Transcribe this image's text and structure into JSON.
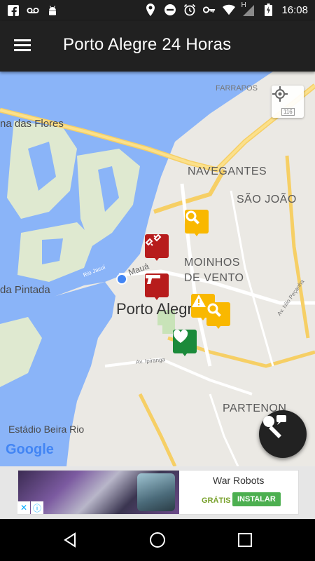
{
  "status_bar": {
    "time": "16:08",
    "left_icons": [
      "facebook-icon",
      "voicemail-icon",
      "android-icon"
    ],
    "right_icons": [
      "location-icon",
      "do-not-disturb-icon",
      "alarm-icon",
      "key-icon",
      "wifi-icon",
      "signal-h-icon",
      "battery-icon"
    ],
    "signal_letter": "H"
  },
  "app_bar": {
    "title": "Porto Alegre 24 Horas",
    "menu_icon": "hamburger-menu-icon"
  },
  "map": {
    "labels": {
      "farrapos": "FARRAPOS",
      "ilha_flores": "na das Flores",
      "navegantes": "NAVEGANTES",
      "sao_joao": "SÃO JOÃO",
      "moinhos": "MOINHOS\nDE VENTO",
      "maua": "Mauá",
      "rio_jacui": "Rio Jacuí",
      "da_pintada": "da Pintada",
      "porto_alegre": "Porto Alegre",
      "av_nilo": "Av. Nilo Peçanha",
      "av_ipiranga": "Av. Ipiranga",
      "partenon": "PARTENON",
      "estadio": "Estádio Beira Rio",
      "highway": "116"
    },
    "google_logo": "Google",
    "locate_icon": "my-location-icon",
    "markers": [
      {
        "name": "chain-incident-marker",
        "icon": "broken-chain-icon",
        "color": "#b71c1c"
      },
      {
        "name": "gun-incident-marker",
        "icon": "gun-icon",
        "color": "#b71c1c"
      },
      {
        "name": "search-marker-1",
        "icon": "magnifier-icon",
        "color": "#f9b800"
      },
      {
        "name": "warning-marker",
        "icon": "warning-icon",
        "color": "#f9b800"
      },
      {
        "name": "search-marker-2",
        "icon": "magnifier-icon",
        "color": "#f9b800"
      },
      {
        "name": "health-marker",
        "icon": "heart-icon",
        "color": "#1b8a3a"
      }
    ],
    "fab_icon": "report-microphone-icon"
  },
  "ad": {
    "title": "War Robots",
    "free_label": "GRÁTIS",
    "install_label": "INSTALAR",
    "close_icon": "ad-close-icon",
    "info_icon": "ad-info-icon",
    "close_glyph": "✕",
    "info_glyph": "ⓘ"
  },
  "nav_bar": {
    "icons": [
      "back-icon",
      "home-icon",
      "recents-icon"
    ]
  }
}
